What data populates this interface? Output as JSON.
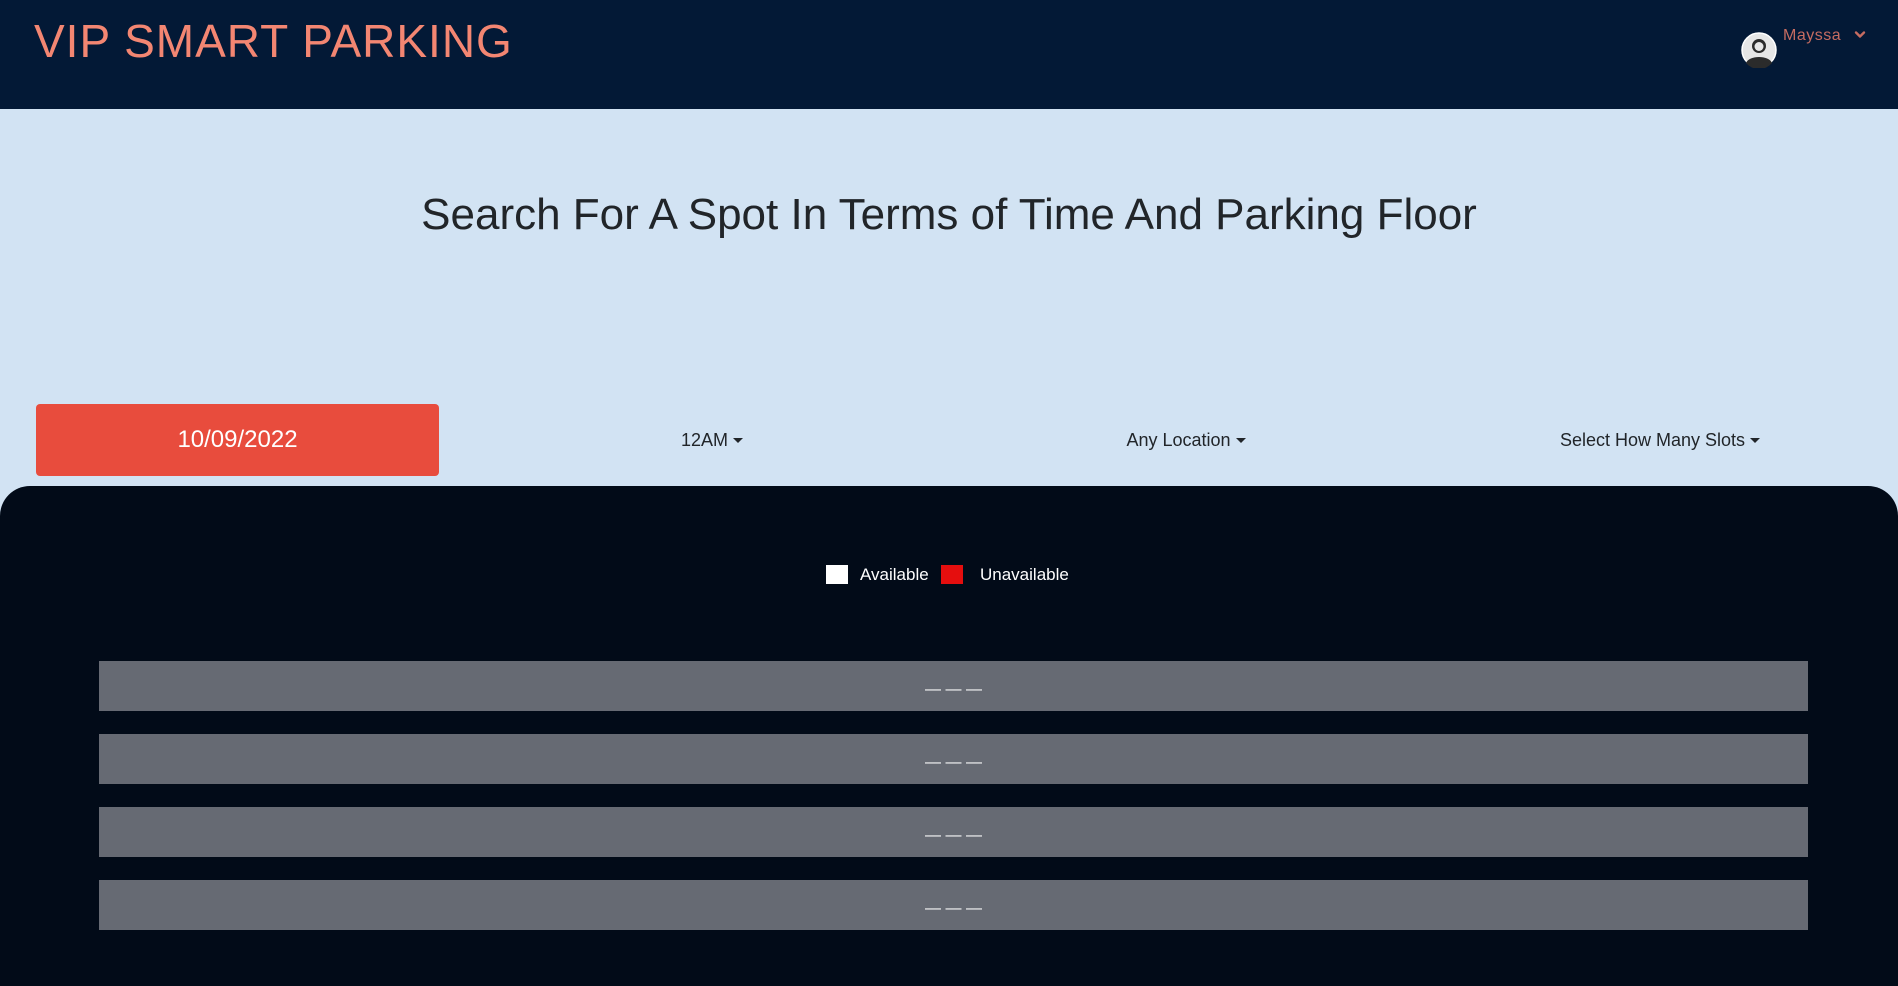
{
  "navbar": {
    "brand": "VIP SMART PARKING",
    "user": {
      "name": "Mayssa",
      "avatar_icon": "user-avatar-icon",
      "caret_icon": "chevron-down-icon"
    }
  },
  "headline": "Search For A Spot In Terms of Time And Parking Floor",
  "filters": {
    "date": "10/09/2022",
    "time": "12AM",
    "location": "Any Location",
    "slots": "Select How Many Slots"
  },
  "legend": {
    "available_label": "Available",
    "unavailable_label": "Unavailable",
    "available_color": "#ffffff",
    "unavailable_color": "#e50e0e"
  },
  "rows": [
    {
      "label": "— — —"
    },
    {
      "label": "— — —"
    },
    {
      "label": "— — —"
    },
    {
      "label": "— — —"
    }
  ],
  "colors": {
    "navbar_bg": "#031936",
    "brand": "#f38672",
    "page_bg": "#d2e3f3",
    "date_button": "#e84c3d",
    "lot_bg": "#020b18",
    "row_bg": "#666a73"
  }
}
